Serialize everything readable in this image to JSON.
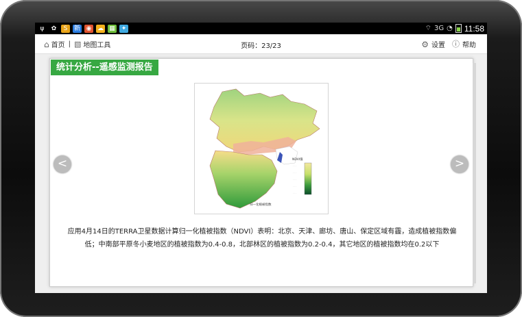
{
  "statusbar": {
    "left_icons": [
      {
        "name": "usb-icon",
        "glyph": "ψ",
        "color": "#000000"
      },
      {
        "name": "settings-app-icon",
        "glyph": "✿",
        "color": "#000000"
      },
      {
        "name": "sogou-app-icon",
        "glyph": "S",
        "color": "#e8a317"
      },
      {
        "name": "news-app-icon",
        "glyph": "新",
        "color": "#2a7de1"
      },
      {
        "name": "chrome-app-icon",
        "glyph": "◉",
        "color": "#e0532f"
      },
      {
        "name": "cloud-app-icon",
        "glyph": "☁",
        "color": "#f3b11c"
      },
      {
        "name": "map-app-icon",
        "glyph": "▦",
        "color": "#6fbf3b"
      },
      {
        "name": "bird-app-icon",
        "glyph": "✦",
        "color": "#3fa9e0"
      }
    ],
    "time": "11:58"
  },
  "nav": {
    "home_label": "首页",
    "separator": "|",
    "map_tools_label": "地图工具",
    "page_indicator": "页码：23/23",
    "settings_label": "设置",
    "help_label": "帮助"
  },
  "report": {
    "title": "统计分析--遥感监测报告",
    "caption": "应用4月14日的TERRA卫星数据计算归一化植被指数（NDVI）表明：北京、天津、廊坊、唐山、保定区域有霾，造成植被指数偏低；中南部平原冬小麦地区的植被指数为0.4-0.8，北部林区的植被指数为0.2-0.4，其它地区的植被指数均在0.2以下",
    "map_legend_title": "NDVI值",
    "map_footer": "归一化植被指数"
  },
  "controls": {
    "prev_label": "<",
    "next_label": ">"
  }
}
